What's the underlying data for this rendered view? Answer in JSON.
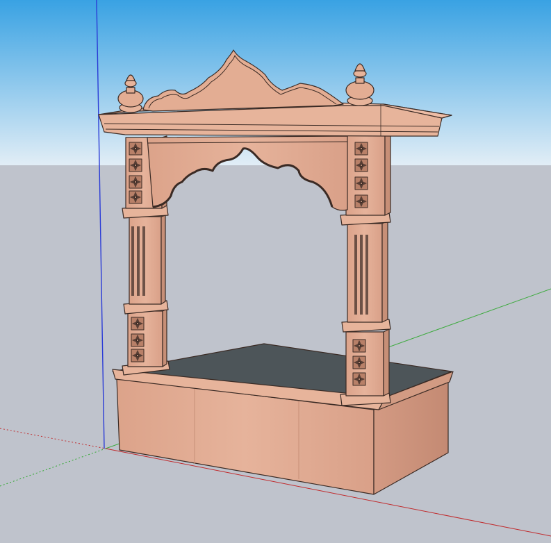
{
  "viewport": {
    "sky_top_color": "#39a2e3",
    "sky_bottom_color": "#e3eef6",
    "ground_color": "#bfc3cc",
    "axis_colors": {
      "red": "#c0292b",
      "green": "#2ea82e",
      "blue": "#2a3bd6"
    }
  },
  "model": {
    "stone_color": "#e3ad93",
    "stone_shadow_color": "#c78f77",
    "outline_color": "#3a2a24",
    "platform_color": "#4d5559"
  }
}
